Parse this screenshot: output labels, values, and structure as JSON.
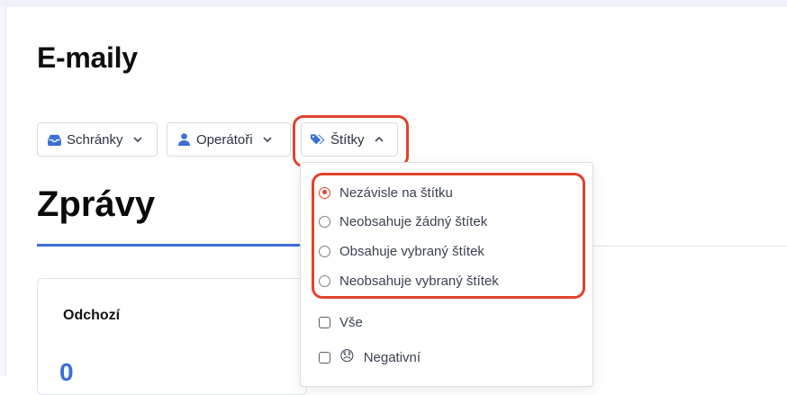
{
  "page": {
    "title": "E-maily"
  },
  "filters": {
    "mailboxes": {
      "label": "Schránky",
      "icon": "inbox-icon"
    },
    "operators": {
      "label": "Operátoři",
      "icon": "user-icon"
    },
    "tags": {
      "label": "Štítky",
      "icon": "tags-icon",
      "expanded": true
    }
  },
  "section": {
    "title": "Zprávy"
  },
  "card": {
    "title": "Odchozí",
    "value": "0"
  },
  "tags_dropdown": {
    "radio_options": [
      {
        "label": "Nezávisle na štítku",
        "selected": true
      },
      {
        "label": "Neobsahuje žádný štítek",
        "selected": false
      },
      {
        "label": "Obsahuje vybraný štítek",
        "selected": false
      },
      {
        "label": "Neobsahuje vybraný štítek",
        "selected": false
      }
    ],
    "checkbox_options": [
      {
        "label": "Vše",
        "checked": false
      },
      {
        "label": "Negativní",
        "emoji": "😞",
        "checked": false
      }
    ]
  },
  "colors": {
    "accent": "#3b6fd8",
    "highlight": "#e0432b",
    "selected_radio": "#e0432b"
  }
}
